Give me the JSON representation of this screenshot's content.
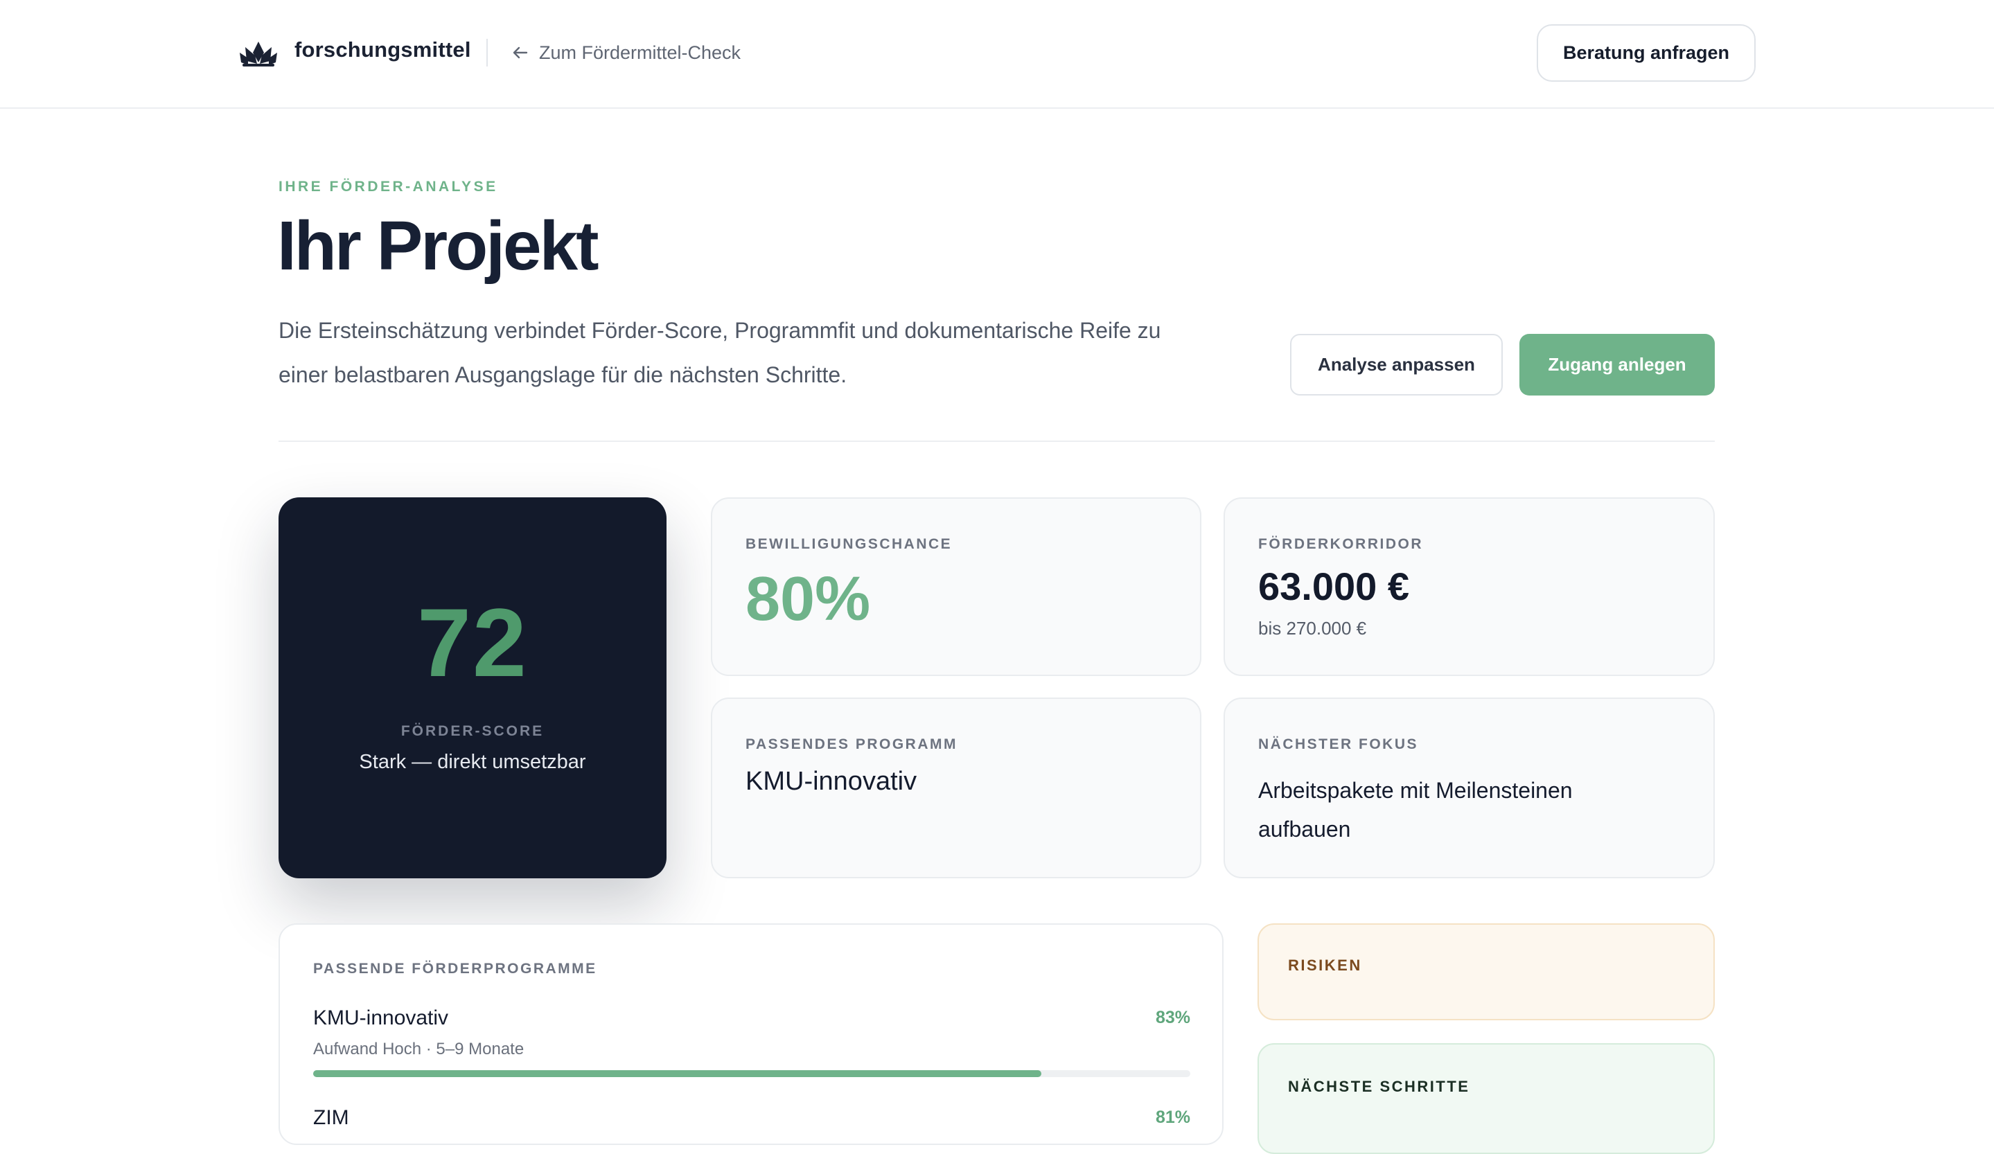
{
  "header": {
    "brand": "forschungsmittel",
    "back_label": "Zum Fördermittel-Check",
    "consult_button": "Beratung anfragen"
  },
  "intro": {
    "eyebrow": "IHRE FÖRDER-ANALYSE",
    "title": "Ihr Projekt",
    "description": "Die Ersteinschätzung verbindet Förder-Score, Programmfit und dokumentarische Reife zu einer belastbaren Ausgangslage für die nächsten Schritte.",
    "adjust_button": "Analyse anpassen",
    "access_button": "Zugang anlegen"
  },
  "score": {
    "value": "72",
    "label": "FÖRDER-SCORE",
    "description": "Stark — direkt umsetzbar"
  },
  "stats": {
    "approval": {
      "label": "BEWILLIGUNGSCHANCE",
      "value": "80%"
    },
    "corridor": {
      "label": "FÖRDERKORRIDOR",
      "value": "63.000 €",
      "sub": "bis 270.000 €"
    },
    "program": {
      "label": "PASSENDES PROGRAMM",
      "value": "KMU-innovativ"
    },
    "focus": {
      "label": "NÄCHSTER FOKUS",
      "value": "Arbeitspakete mit Meilensteinen aufbauen"
    }
  },
  "programs": {
    "label": "PASSENDE FÖRDERPROGRAMME",
    "items": [
      {
        "name": "KMU-innovativ",
        "percent_label": "83%",
        "fit": 0.83,
        "meta": "Aufwand Hoch · 5–9 Monate"
      },
      {
        "name": "ZIM",
        "percent_label": "81%",
        "fit": 0.81,
        "meta": ""
      }
    ]
  },
  "side": {
    "risks_label": "RISIKEN",
    "steps_label": "NÄCHSTE SCHRITTE"
  },
  "colors": {
    "accent": "#6fb38a",
    "dark": "#131a2b",
    "risk_bg": "#fdf7ee",
    "steps_bg": "#f1f9f3"
  }
}
